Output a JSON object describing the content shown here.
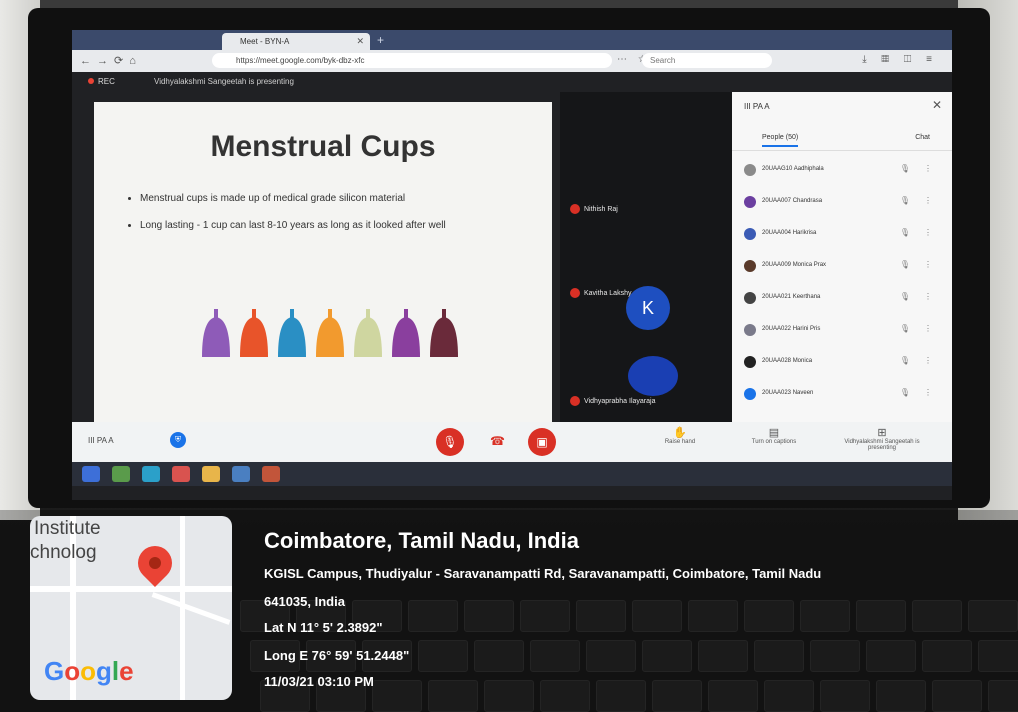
{
  "browser": {
    "tab_title": "Meet - BYN-A",
    "url": "https://meet.google.com/byk-dbz-xfc",
    "search_placeholder": "Search"
  },
  "meet": {
    "rec_label": "REC",
    "presenting_text": "Vidhyalakshmi Sangeetah is presenting",
    "meeting_code": "III PA A"
  },
  "slide": {
    "title": "Menstrual Cups",
    "bullets": [
      "Menstrual cups is made up of medical grade silicon material",
      "Long lasting - 1 cup can last 8-10 years as long as it looked after well"
    ],
    "cup_colors": [
      "#8e5bb8",
      "#e8542a",
      "#2a8fc4",
      "#f29a2e",
      "#cfd6a0",
      "#8a3f9e",
      "#6a2a3a"
    ]
  },
  "tiles": {
    "names": [
      "Nithish Raj",
      "Kavitha Lakshy",
      "Vidhyaprabha Ilayaraja"
    ],
    "avatar_letter": "K"
  },
  "panel": {
    "title": "III PA A",
    "people_tab": "People (50)",
    "chat_tab": "Chat",
    "participants": [
      "20UAAG10 Aadhiphala",
      "20UAA007 Chandrasa",
      "20UAA004 Harikrisa",
      "20UAA009 Monica Prax",
      "20UAA021 Keerthana",
      "20UAA022 Harini Pris",
      "20UAA028 Monica",
      "20UAA023 Naveen"
    ]
  },
  "controls": {
    "meeting_label": "III PA A",
    "raise_hand": "Raise hand",
    "captions": "Turn on captions",
    "presenting": "Vidhyalakshmi Sangeetah is presenting"
  },
  "geotag": {
    "city": "Coimbatore, Tamil Nadu, India",
    "address_line1": "KGISL Campus, Thudiyalur - Saravanampatti Rd, Saravanampatti, Coimbatore, Tamil Nadu",
    "address_line2": "641035, India",
    "lat": "Lat N 11° 5' 2.3892\"",
    "long": "Long E 76° 59' 51.2448\"",
    "datetime": "11/03/21 03:10 PM",
    "map_label_1": "Institute",
    "map_label_2": "chnolog",
    "google_letters": [
      "G",
      "o",
      "o",
      "g",
      "l",
      "e"
    ]
  }
}
